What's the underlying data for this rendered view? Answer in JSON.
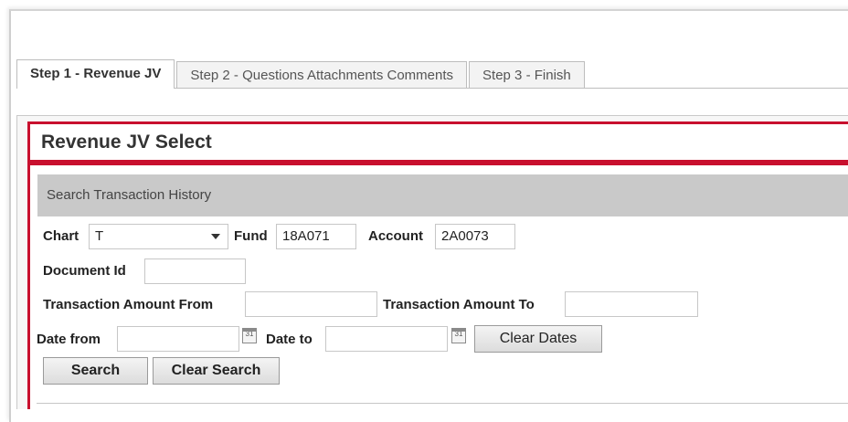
{
  "tabs": [
    {
      "label": "Step 1 - Revenue JV",
      "active": true
    },
    {
      "label": "Step 2 - Questions Attachments Comments",
      "active": false
    },
    {
      "label": "Step 3 - Finish",
      "active": false
    }
  ],
  "card": {
    "title": "Revenue JV Select",
    "section_title": "Search Transaction History"
  },
  "form": {
    "chart_label": "Chart",
    "chart_value": "T",
    "fund_label": "Fund",
    "fund_value": "18A071",
    "account_label": "Account",
    "account_value": "2A0073",
    "document_id_label": "Document Id",
    "document_id_value": "",
    "amount_from_label": "Transaction Amount From",
    "amount_from_value": "",
    "amount_to_label": "Transaction Amount To",
    "amount_to_value": "",
    "date_from_label": "Date from",
    "date_from_value": "",
    "date_to_label": "Date to",
    "date_to_value": "",
    "calendar_day": "31"
  },
  "buttons": {
    "clear_dates": "Clear Dates",
    "search": "Search",
    "clear_search": "Clear Search"
  },
  "colors": {
    "accent": "#c8102e",
    "section_bar": "#c9c9c9"
  },
  "icons": {
    "dropdown": "chevron-down-icon",
    "calendar": "calendar-icon"
  }
}
